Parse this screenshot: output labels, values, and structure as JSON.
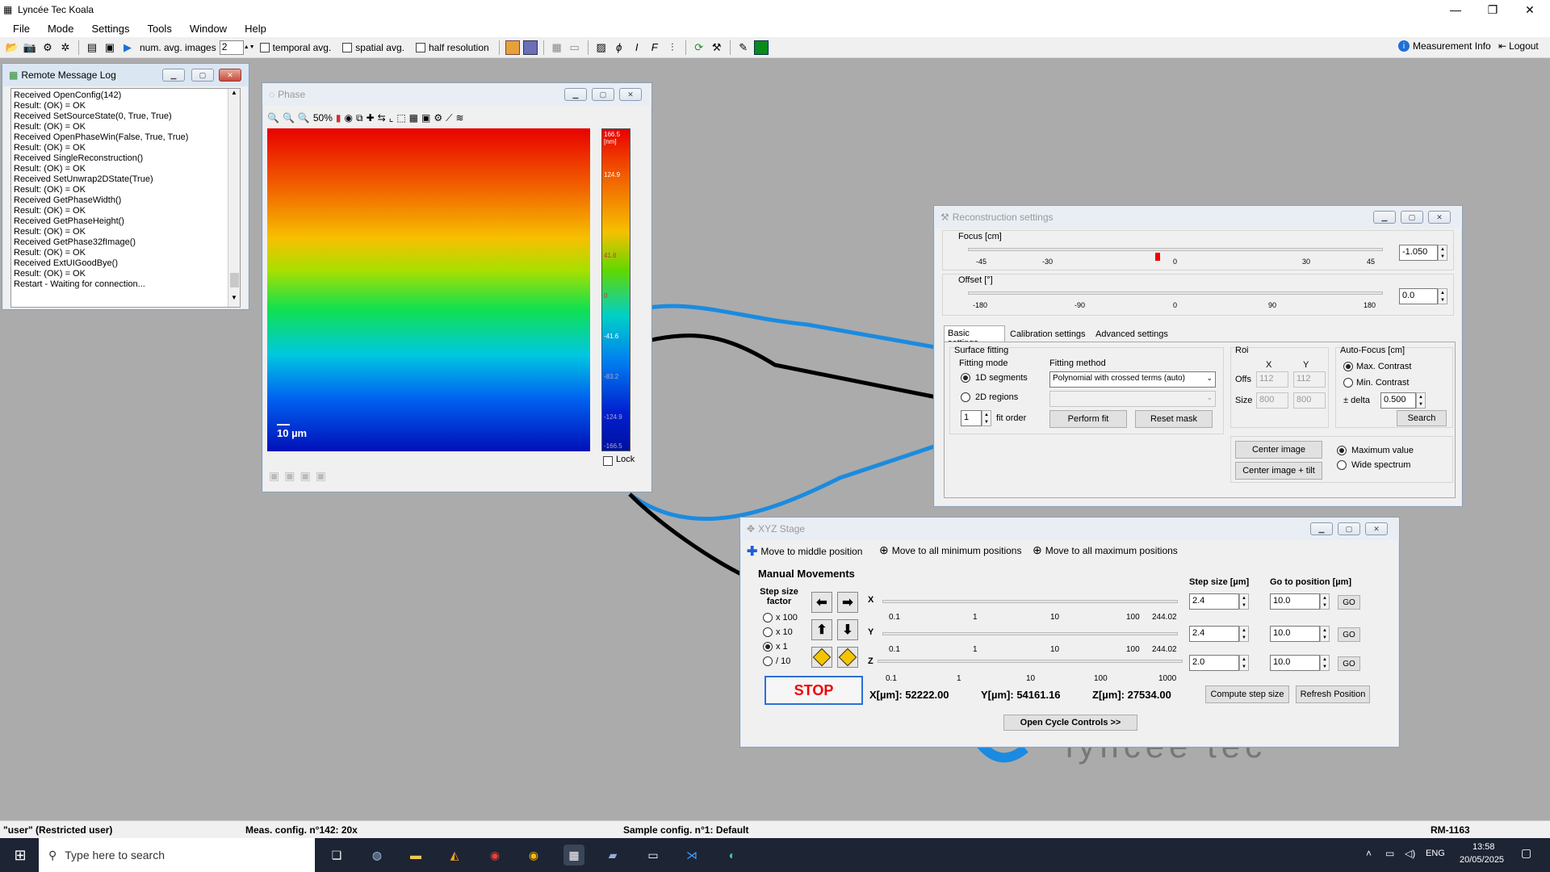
{
  "app": {
    "title": "Lyncée Tec Koala"
  },
  "menu": [
    "File",
    "Mode",
    "Settings",
    "Tools",
    "Window",
    "Help"
  ],
  "toolbar": {
    "num_avg_label": "num. avg. images",
    "num_avg_value": "2",
    "temporal_label": "temporal avg.",
    "spatial_label": "spatial avg.",
    "half_res_label": "half resolution",
    "measurement_info": "Measurement Info",
    "logout": "Logout"
  },
  "log": {
    "title": "Remote Message Log",
    "lines": [
      "Received OpenConfig(142)",
      "Result: (OK) = OK",
      "Received SetSourceState(0, True, True)",
      "Result: (OK) = OK",
      "Received OpenPhaseWin(False, True, True)",
      "Result: (OK) = OK",
      "Received SingleReconstruction()",
      "Result: (OK) = OK",
      "Received SetUnwrap2DState(True)",
      "Result: (OK) = OK",
      "Received GetPhaseWidth()",
      "Result: (OK) = OK",
      "Received GetPhaseHeight()",
      "Result: (OK) = OK",
      "Received GetPhase32fImage()",
      "Result: (OK) = OK",
      "Received ExtUIGoodBye()",
      "Result: (OK) = OK",
      "Restart - Waiting for connection..."
    ]
  },
  "phase": {
    "title": "Phase",
    "zoom": "50%",
    "scale_bar": "10 µm",
    "colorbar_labels": [
      "166.5\n[nm]",
      "124.9",
      "41.6",
      "0",
      "-41.6",
      "-83.2",
      "-124.9",
      "-166.5"
    ],
    "lock_label": "Lock"
  },
  "recon": {
    "title": "Reconstruction settings",
    "focus_label": "Focus [cm]",
    "focus_ticks": [
      "-45",
      "-30",
      "0",
      "30",
      "45"
    ],
    "focus_value": "-1.050",
    "offset_label": "Offset [°]",
    "offset_ticks": [
      "-180",
      "-90",
      "0",
      "90",
      "180"
    ],
    "offset_value": "0.0",
    "tabs": [
      "Basic settings",
      "Calibration settings",
      "Advanced settings"
    ],
    "surface_fitting": "Surface fitting",
    "fitting_mode": "Fitting mode",
    "mode_1d": "1D segments",
    "mode_2d": "2D regions",
    "fitting_method": "Fitting method",
    "method_value": "Polynomial with crossed terms (auto)",
    "fit_order_value": "1",
    "fit_order_label": "fit order",
    "perform_fit": "Perform fit",
    "reset_mask": "Reset mask",
    "roi": "Roi",
    "roi_x": "X",
    "roi_y": "Y",
    "offs": "Offs",
    "size": "Size",
    "offs_x": "112",
    "offs_y": "112",
    "size_x": "800",
    "size_y": "800",
    "autofocus": "Auto-Focus [cm]",
    "max_contrast": "Max. Contrast",
    "min_contrast": "Min. Contrast",
    "delta_label": "± delta",
    "delta_value": "0.500",
    "search": "Search",
    "center_image": "Center image",
    "center_tilt": "Center image + tilt",
    "max_value": "Maximum value",
    "wide_spectrum": "Wide spectrum"
  },
  "xyz": {
    "title": "XYZ Stage",
    "move_middle": "Move to middle position",
    "move_min": "Move to all minimum positions",
    "move_max": "Move to all maximum positions",
    "manual": "Manual Movements",
    "step_factor": "Step size factor",
    "factors": [
      "x 100",
      "x 10",
      "x 1",
      "/ 10"
    ],
    "stop": "STOP",
    "step_header": "Step size [µm]",
    "goto_header": "Go to position [µm]",
    "x_label": "X",
    "y_label": "Y",
    "z_label": "Z",
    "xy_ticks": [
      "0.1",
      "1",
      "10",
      "100",
      "244.02"
    ],
    "z_ticks": [
      "0.1",
      "1",
      "10",
      "100",
      "1000"
    ],
    "step_x": "2.4",
    "step_y": "2.4",
    "step_z": "2.0",
    "goto_x": "10.0",
    "goto_y": "10.0",
    "goto_z": "10.0",
    "go": "GO",
    "x_pos": "X[µm]: 52222.00",
    "y_pos": "Y[µm]: 54161.16",
    "z_pos": "Z[µm]: 27534.00",
    "compute_step": "Compute step size",
    "refresh_pos": "Refresh Position",
    "cycle": "Open Cycle Controls >>"
  },
  "status": {
    "user": "\"user\" (Restricted user)",
    "meas": "Meas. config. n°142: 20x",
    "sample": "Sample config. n°1: Default",
    "rm": "RM-1163"
  },
  "taskbar": {
    "search": "Type here to search",
    "lang": "ENG",
    "time": "13:58",
    "date": "20/05/2025"
  },
  "logo_text": "lyncée tec"
}
